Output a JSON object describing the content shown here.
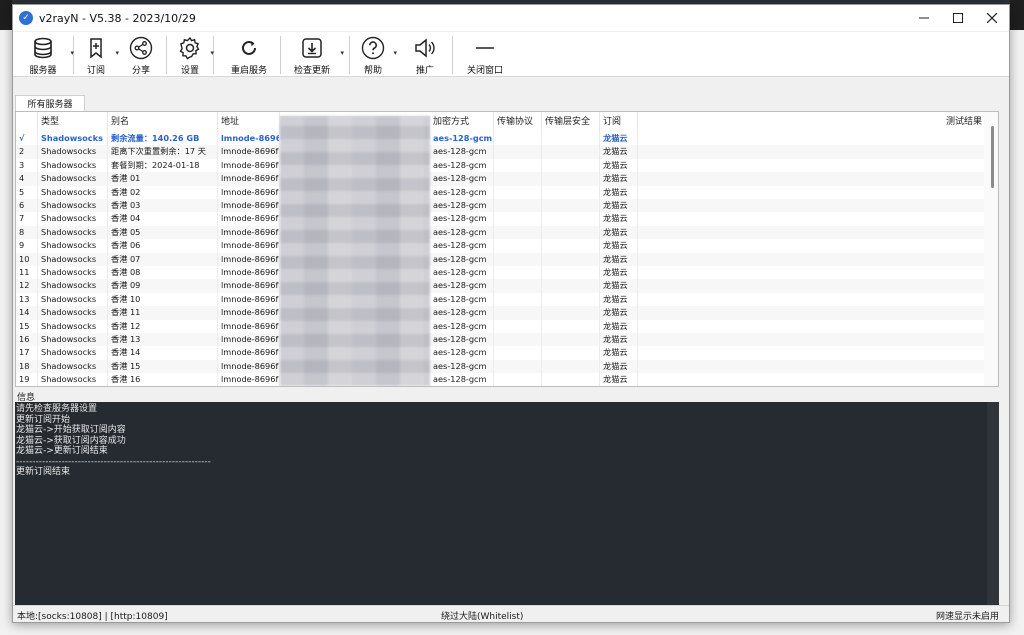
{
  "window": {
    "title": "v2rayN - V5.38 - 2023/10/29"
  },
  "toolbar": [
    {
      "label": "服务器",
      "icon": "database-icon",
      "caret": true
    },
    {
      "label": "订阅",
      "icon": "add-bookmark-icon",
      "caret": true
    },
    {
      "label": "分享",
      "icon": "share-icon",
      "caret": false
    },
    {
      "label": "设置",
      "icon": "gear-icon",
      "caret": true
    },
    {
      "label": "重启服务",
      "icon": "restart-icon",
      "caret": false
    },
    {
      "label": "检查更新",
      "icon": "download-icon",
      "caret": true
    },
    {
      "label": "帮助",
      "icon": "help-icon",
      "caret": true
    },
    {
      "label": "推广",
      "icon": "speaker-icon",
      "caret": false
    },
    {
      "label": "关闭窗口",
      "icon": "minimize-line-icon",
      "caret": false
    }
  ],
  "tab": {
    "label": "所有服务器"
  },
  "columns": [
    "类型",
    "别名",
    "地址",
    "",
    "",
    "加密方式",
    "传输协议",
    "传输层安全",
    "订阅",
    "测试结果"
  ],
  "rows": [
    {
      "num": "√",
      "type": "Shadowsocks",
      "alias": "剩余流量：140.26 GB",
      "address": "lmnode-8696",
      "enc": "aes-128-gcm",
      "sub": "龙猫云"
    },
    {
      "num": "2",
      "type": "Shadowsocks",
      "alias": "距离下次重置剩余：17 天",
      "address": "lmnode-8696f83",
      "enc": "aes-128-gcm",
      "sub": "龙猫云"
    },
    {
      "num": "3",
      "type": "Shadowsocks",
      "alias": "套餐到期：2024-01-18",
      "address": "lmnode-8696f83",
      "enc": "aes-128-gcm",
      "sub": "龙猫云"
    },
    {
      "num": "4",
      "type": "Shadowsocks",
      "alias": "香港 01",
      "address": "lmnode-8696f83",
      "enc": "aes-128-gcm",
      "sub": "龙猫云"
    },
    {
      "num": "5",
      "type": "Shadowsocks",
      "alias": "香港 02",
      "address": "lmnode-8696f83",
      "enc": "aes-128-gcm",
      "sub": "龙猫云"
    },
    {
      "num": "6",
      "type": "Shadowsocks",
      "alias": "香港 03",
      "address": "lmnode-8696f83",
      "enc": "aes-128-gcm",
      "sub": "龙猫云"
    },
    {
      "num": "7",
      "type": "Shadowsocks",
      "alias": "香港 04",
      "address": "lmnode-8696f83",
      "enc": "aes-128-gcm",
      "sub": "龙猫云"
    },
    {
      "num": "8",
      "type": "Shadowsocks",
      "alias": "香港 05",
      "address": "lmnode-8696f83",
      "enc": "aes-128-gcm",
      "sub": "龙猫云"
    },
    {
      "num": "9",
      "type": "Shadowsocks",
      "alias": "香港 06",
      "address": "lmnode-8696f83",
      "enc": "aes-128-gcm",
      "sub": "龙猫云"
    },
    {
      "num": "10",
      "type": "Shadowsocks",
      "alias": "香港 07",
      "address": "lmnode-8696f83",
      "enc": "aes-128-gcm",
      "sub": "龙猫云"
    },
    {
      "num": "11",
      "type": "Shadowsocks",
      "alias": "香港 08",
      "address": "lmnode-8696f83",
      "enc": "aes-128-gcm",
      "sub": "龙猫云"
    },
    {
      "num": "12",
      "type": "Shadowsocks",
      "alias": "香港 09",
      "address": "lmnode-8696f83",
      "enc": "aes-128-gcm",
      "sub": "龙猫云"
    },
    {
      "num": "13",
      "type": "Shadowsocks",
      "alias": "香港 10",
      "address": "lmnode-8696f83",
      "enc": "aes-128-gcm",
      "sub": "龙猫云"
    },
    {
      "num": "14",
      "type": "Shadowsocks",
      "alias": "香港 11",
      "address": "lmnode-8696f83",
      "enc": "aes-128-gcm",
      "sub": "龙猫云"
    },
    {
      "num": "15",
      "type": "Shadowsocks",
      "alias": "香港 12",
      "address": "lmnode-8696f83",
      "enc": "aes-128-gcm",
      "sub": "龙猫云"
    },
    {
      "num": "16",
      "type": "Shadowsocks",
      "alias": "香港 13",
      "address": "lmnode-8696f83",
      "enc": "aes-128-gcm",
      "sub": "龙猫云"
    },
    {
      "num": "17",
      "type": "Shadowsocks",
      "alias": "香港 14",
      "address": "lmnode-8696f83",
      "enc": "aes-128-gcm",
      "sub": "龙猫云"
    },
    {
      "num": "18",
      "type": "Shadowsocks",
      "alias": "香港 15",
      "address": "lmnode-8696f83",
      "enc": "aes-128-gcm",
      "sub": "龙猫云"
    },
    {
      "num": "19",
      "type": "Shadowsocks",
      "alias": "香港 16",
      "address": "lmnode-8696f83",
      "enc": "aes-128-gcm",
      "sub": "龙猫云"
    }
  ],
  "log": {
    "label": "信息",
    "lines": [
      "请先检查服务器设置",
      "更新订阅开始",
      "龙猫云->开始获取订阅内容",
      "龙猫云->获取订阅内容成功",
      "龙猫云->更新订阅结束",
      "------------------------------------------------------------",
      "更新订阅结束"
    ]
  },
  "status": {
    "local": "本地:[socks:10808] | [http:10809]",
    "routing": "绕过大陆(Whitelist)",
    "speed": "网速显示未启用"
  },
  "colors": {
    "selected_text": "#2a62c9",
    "log_bg": "#252b31"
  }
}
